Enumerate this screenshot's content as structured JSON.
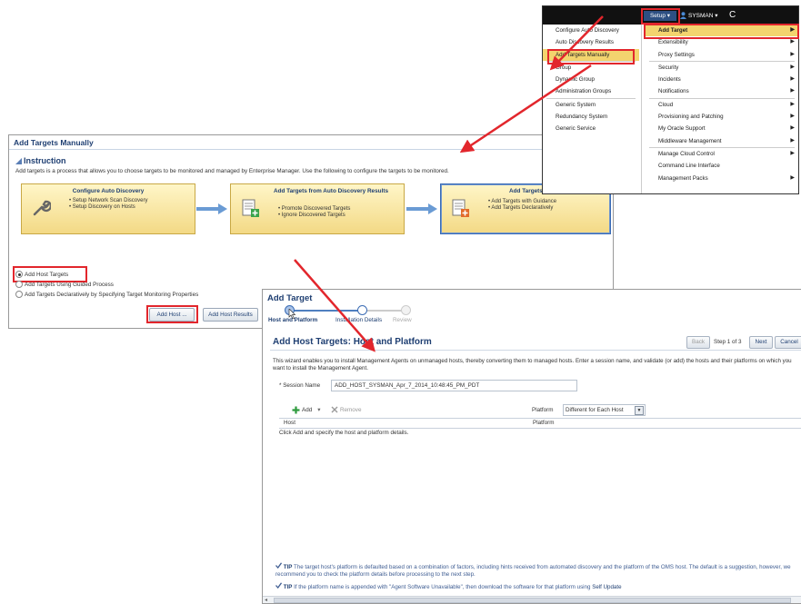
{
  "panel_a": {
    "title": "Add Targets Manually",
    "instruction_heading": "Instruction",
    "instruction_text": "Add targets is a process that allows you to choose targets to be monitored and managed by Enterprise Manager. Use the following to configure the targets to be monitored.",
    "steps": [
      {
        "title": "Configure Auto Discovery",
        "items": [
          "• Setup Network Scan Discovery",
          "• Setup Discovery on Hosts"
        ],
        "icon": "wrench-icon"
      },
      {
        "title": "Add Targets from Auto Discovery Results",
        "items": [
          "• Promote Discovered Targets",
          "• Ignore Discovered Targets"
        ],
        "icon": "document-plus-icon"
      },
      {
        "title": "Add Targets Manually",
        "items": [
          "• Add Targets with Guidance",
          "• Add Targets Declaratively"
        ],
        "icon": "document-plus-icon"
      }
    ],
    "radio_options": [
      {
        "label": "Add Host Targets",
        "selected": true
      },
      {
        "label": "Add Targets Using Guided Process",
        "selected": false
      },
      {
        "label": "Add Targets Declaratively by Specifying Target Monitoring Properties",
        "selected": false
      }
    ],
    "add_host_button": "Add Host ...",
    "add_host_results_button": "Add Host Results"
  },
  "panel_b": {
    "setup_label": "Setup ▾",
    "user_label": "SYSMAN ▾",
    "left_menu": [
      [
        "Configure Auto Discovery",
        "Auto Discovery Results",
        "Add Targets Manually"
      ],
      [
        "Group",
        "Dynamic Group",
        "Administration Groups"
      ],
      [
        "Generic System",
        "Redundancy System",
        "Generic Service"
      ]
    ],
    "right_menu": [
      [
        "Add Target",
        "Extensibility",
        "Proxy Settings"
      ],
      [
        "Security",
        "Incidents",
        "Notifications"
      ],
      [
        "Cloud",
        "Provisioning and Patching",
        "My Oracle Support",
        "Middleware Management"
      ],
      [
        "Manage Cloud Control",
        "Command Line Interface",
        "Management Packs"
      ]
    ],
    "right_menu_arrows": [
      [
        true,
        true,
        true
      ],
      [
        true,
        true,
        true
      ],
      [
        true,
        true,
        true,
        true
      ],
      [
        true,
        false,
        true
      ]
    ]
  },
  "panel_c": {
    "title": "Add Target",
    "train": [
      "Host and Platform",
      "Installation Details",
      "Review"
    ],
    "section_title": "Add Host Targets: Host and Platform",
    "back_button": "Back",
    "step_of": "Step 1 of 3",
    "next_button": "Next",
    "cancel_button": "Cancel",
    "description": "This wizard enables you to install Management Agents on unmanaged hosts, thereby converting them to managed hosts. Enter a session name, and validate (or add) the hosts and their platforms on which you want to install the Management Agent.",
    "session_label": "* Session Name",
    "session_value": "ADD_HOST_SYSMAN_Apr_7_2014_10:48:45_PM_PDT",
    "add_label": "Add",
    "remove_label": "Remove",
    "platform_label": "Platform",
    "platform_value": "Different for Each Host",
    "table_headers": [
      "Host",
      "Platform"
    ],
    "table_empty": "Click Add and specify the host and platform details.",
    "tip_label": "TIP",
    "tip1": "The target host's platform is defaulted based on a combination of factors, including hints received from automated discovery and the platform of the OMS host. The default is a suggestion, however, we recommend you to check the platform details before processing to the next step.",
    "tip2": "If the platform name is appended with \"Agent Software Unavailable\", then download the software for that platform using",
    "tip2_link": "Self Update"
  },
  "colors": {
    "annotation_red": "#e2262c",
    "header_blue": "#1f3f72",
    "step_yellow": "#f3d985",
    "menu_highlight": "#f3d46e"
  }
}
